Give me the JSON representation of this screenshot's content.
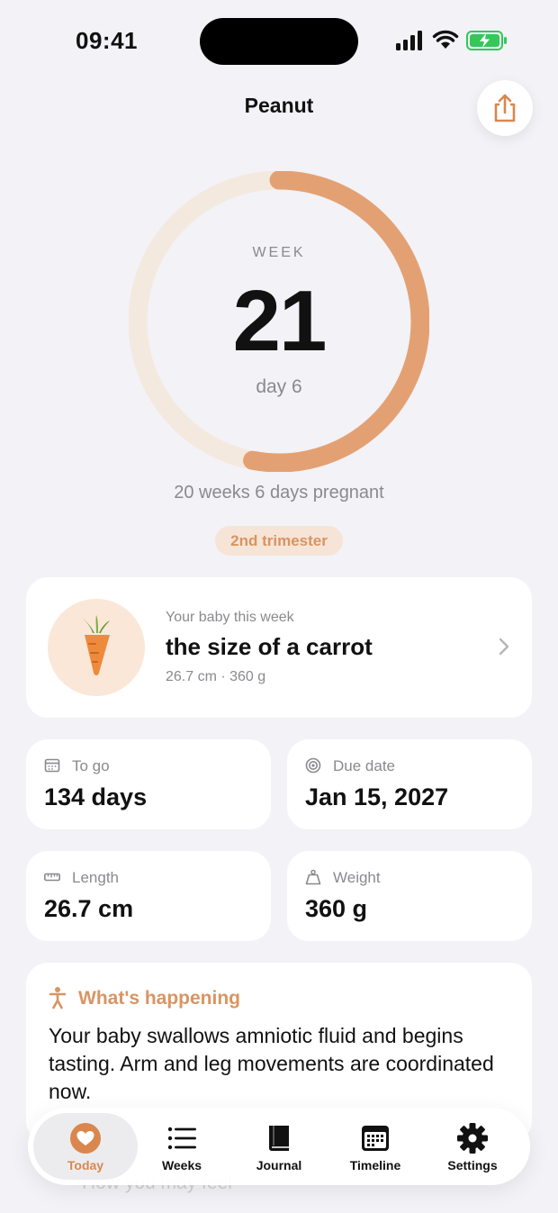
{
  "status": {
    "time": "09:41"
  },
  "header": {
    "title": "Peanut"
  },
  "progress": {
    "week_label": "WEEK",
    "week_number": "21",
    "day_label": "day 6",
    "ring_fraction": 0.53,
    "summary": "20 weeks 6 days pregnant",
    "trimester": "2nd trimester"
  },
  "baby": {
    "caption": "Your baby this week",
    "size": "the size of a carrot",
    "measure": "26.7 cm · 360 g"
  },
  "stats": {
    "to_go_label": "To go",
    "to_go_value": "134 days",
    "due_label": "Due date",
    "due_value": "Jan 15, 2027",
    "length_label": "Length",
    "length_value": "26.7 cm",
    "weight_label": "Weight",
    "weight_value": "360 g"
  },
  "happening": {
    "title": "What's happening",
    "text": "Your baby swallows amniotic fluid and begins tasting. Arm and leg movements are coordinated now."
  },
  "peek": {
    "title": "How you may feel"
  },
  "tabs": [
    {
      "label": "Today",
      "icon": "heart-icon"
    },
    {
      "label": "Weeks",
      "icon": "list-icon"
    },
    {
      "label": "Journal",
      "icon": "book-icon"
    },
    {
      "label": "Timeline",
      "icon": "calendar-icon"
    },
    {
      "label": "Settings",
      "icon": "gear-icon"
    }
  ],
  "colors": {
    "accent": "#d9874f",
    "ring_track": "#f4e9df",
    "ring_fill": "#e3a173",
    "background": "#f2f2f7"
  }
}
